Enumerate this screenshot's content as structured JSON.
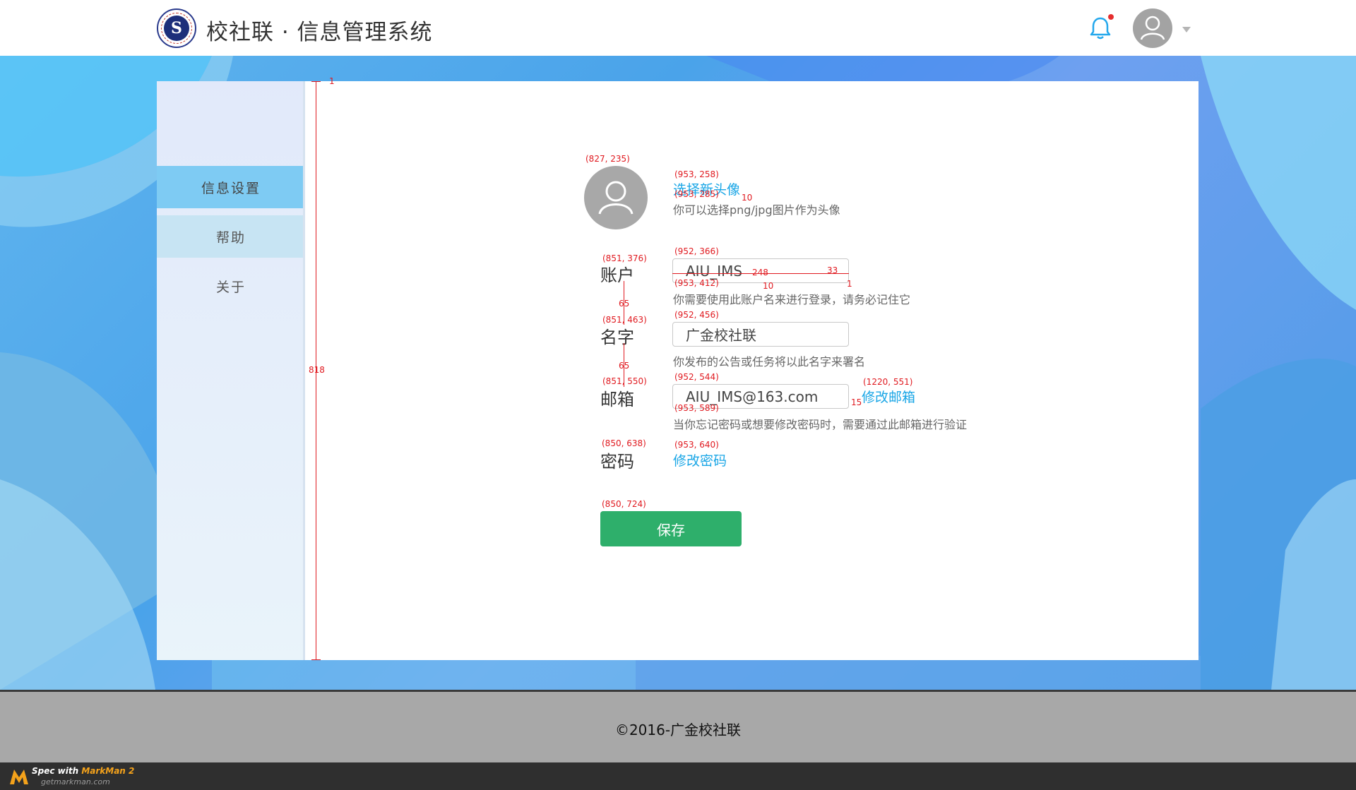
{
  "header": {
    "app_title": "校社联 · 信息管理系统",
    "logo_letter": "S"
  },
  "sidebar": {
    "items": [
      {
        "label": "信息设置",
        "active": true
      },
      {
        "label": "帮助",
        "active": false
      },
      {
        "label": "关于",
        "active": false
      }
    ]
  },
  "profile": {
    "change_avatar_link": "选择新头像",
    "avatar_hint": "你可以选择png/jpg图片作为头像",
    "account_label": "账户",
    "account_value": "AIU_IMS",
    "account_hint": "你需要使用此账户名来进行登录，请务必记住它",
    "name_label": "名字",
    "name_value": "广金校社联",
    "name_hint": "你发布的公告或任务将以此名字来署名",
    "email_label": "邮箱",
    "email_value": "AIU_IMS@163.com",
    "change_email_link": "修改邮箱",
    "email_hint": "当你忘记密码或想要修改密码时，需要通过此邮箱进行验证",
    "password_label": "密码",
    "change_password_link": "修改密码",
    "save_label": "保存"
  },
  "footer": {
    "copyright": "©2016-广金校社联"
  },
  "markman": {
    "line1_prefix": "Spec with ",
    "line1_brand": "MarkMan 2",
    "line2": "getmarkman.com"
  },
  "annotations": {
    "a_1": "1",
    "a_818": "818",
    "a_avatar": "(827, 235)",
    "a_choose": "(953, 258)",
    "a_hint1": "(953, 285)",
    "a_10a": "10",
    "a_acc_label": "(851, 376)",
    "a_acc_input": "(952, 366)",
    "a_248": "248",
    "a_33": "33",
    "a_1b": "1",
    "a_acc_hint": "(953, 412)",
    "a_10b": "10",
    "a_65a": "65",
    "a_name_label": "(851, 463)",
    "a_name_input": "(952, 456)",
    "a_65b": "65",
    "a_email_label": "(851, 550)",
    "a_email_input": "(952, 544)",
    "a_email_link": "(1220, 551)",
    "a_15": "15",
    "a_email_hint": "(953, 589)",
    "a_pwd_label": "(850, 638)",
    "a_pwd_link": "(953, 640)",
    "a_save": "(850, 724)"
  },
  "colors": {
    "accent_blue": "#1aa6e6",
    "save_green": "#2eaf6b",
    "sidebar_active": "#7ecbf3",
    "annotation_red": "#e0191f"
  }
}
